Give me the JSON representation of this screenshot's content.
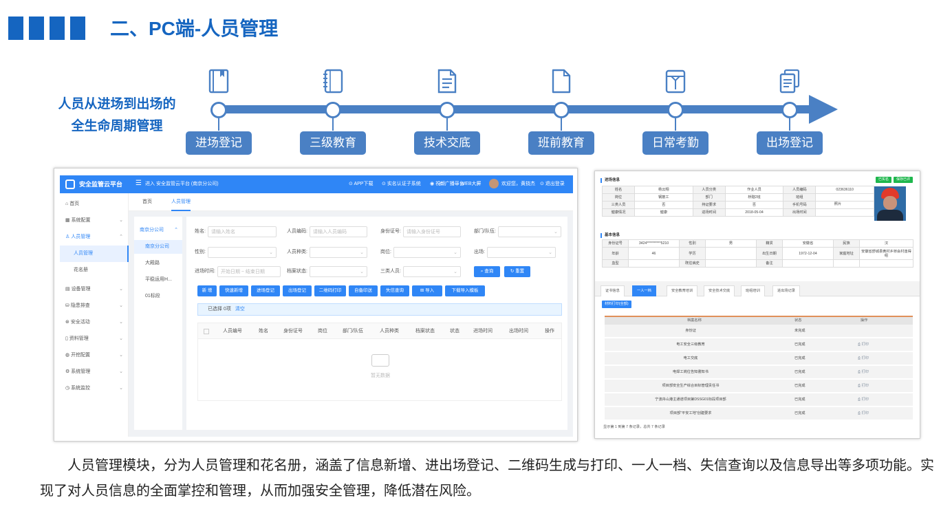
{
  "header": {
    "title": "二、PC端-人员管理"
  },
  "lifecycle": {
    "caption_line1": "人员从进场到出场的",
    "caption_line2": "全生命周期管理",
    "stages": [
      {
        "label": "进场登记",
        "icon": "book-icon"
      },
      {
        "label": "三级教育",
        "icon": "notebook-icon"
      },
      {
        "label": "技术交底",
        "icon": "document-icon"
      },
      {
        "label": "班前教育",
        "icon": "file-icon"
      },
      {
        "label": "日常考勤",
        "icon": "clipboard-icon"
      },
      {
        "label": "出场登记",
        "icon": "copy-icon"
      }
    ],
    "accent_color": "#4a80c4"
  },
  "shot1": {
    "brand": "安全监管云平台",
    "company": "进入 安全监管云平台 (南京分公司)",
    "nav": [
      "APP下载",
      "实名认证子系统",
      "視频",
      "WEB大屏",
      "广播平台",
      "欢迎您，黄挠杰",
      "退出登录"
    ],
    "sidebar": [
      "首页",
      "系统配置",
      "人员管理",
      "人员管理",
      "花名册",
      "设备管理",
      "隐患排查",
      "安全活动",
      "资料管理",
      "开挖配置",
      "系统管理",
      "系统监控"
    ],
    "tabs": [
      "首页",
      "人员管理"
    ],
    "tree": [
      "南京分公司",
      "南京分公司",
      "大殿路",
      "平稳运用H...",
      "01标段"
    ],
    "form": {
      "name_label": "姓名:",
      "name_ph": "请输入姓名",
      "code_label": "人员编码:",
      "code_ph": "请输入人员编码",
      "id_label": "身份证号:",
      "id_ph": "请输入身份证号",
      "team_label": "部门/队伍:",
      "gender_label": "性别:",
      "type_label": "人员种类:",
      "post_label": "岗位:",
      "exit_label": "出场:",
      "time_label": "进场时间:",
      "time_ph": "开始日期 ~ 结束日期",
      "archive_label": "档案状态:",
      "three_label": "三类人员:",
      "search_btn": "查询",
      "reset_btn": "重置"
    },
    "actions": [
      "新 增",
      "快速新增",
      "进场登记",
      "出场登记",
      "二维码打印",
      "自备印送",
      "失信查询",
      "导入",
      "下载导入模板"
    ],
    "selected_text": "已选择 0项",
    "clear_text": "清空",
    "columns": [
      "人员编号",
      "姓名",
      "身份证号",
      "岗位",
      "部门/队伍",
      "人员种类",
      "档案状态",
      "状态",
      "进场时间",
      "出场时间",
      "操作"
    ],
    "empty_text": "暂无数据"
  },
  "shot2": {
    "sec_entry": "进场信息",
    "badges": [
      "已实名",
      "保存已评"
    ],
    "entry_rows": [
      [
        "姓名",
        "杨云翔",
        "人员分类",
        "作业人员",
        "人员编码",
        "023636110"
      ],
      [
        "岗位",
        "钢筋工",
        "部门",
        "桥隧2班",
        "班组",
        ""
      ],
      [
        "三类人员",
        "否",
        "持证要求",
        "否",
        "手机号码",
        ""
      ],
      [
        "健康情况",
        "健康",
        "进场时间",
        "2018-05-04",
        "出场时间",
        ""
      ]
    ],
    "photo_label": "照片",
    "sec_basic": "基本信息",
    "basic_rows": [
      [
        "身份证号",
        "3424**********5210",
        "性别",
        "男",
        "籍贯",
        "安徽省",
        "民族",
        "汉"
      ],
      [
        "年龄",
        "46",
        "学历",
        "",
        "出生日期",
        "1972-12-04",
        "家庭地址",
        "安徽省舒城县黄村乡桥会村逢得组"
      ],
      [
        "血型",
        "",
        "既往病史",
        "",
        "备注",
        "",
        "",
        ""
      ]
    ],
    "tabs": [
      "证书信息",
      "一人一档",
      "安全教育培训",
      "安全技术交底",
      "班组培训",
      "进出场记录"
    ],
    "print_btn": "材料打印(全部)",
    "doc_headers": [
      "档案名称",
      "状态",
      "操作"
    ],
    "docs": [
      {
        "name": "身份证",
        "status": "未完成",
        "action": ""
      },
      {
        "name": "电工安全三级教育",
        "status": "已完成",
        "action": "打印"
      },
      {
        "name": "电工交底",
        "status": "已完成",
        "action": "打印"
      },
      {
        "name": "电焊工岗位告知書知书",
        "status": "已完成",
        "action": "打印"
      },
      {
        "name": "项目部安全生产综合目标管理责任书",
        "status": "已完成",
        "action": "打印"
      },
      {
        "name": "宁波舟山港主通道项目第DSSG01标段项目部",
        "status": "已完成",
        "action": "打印"
      },
      {
        "name": "项目部\"平安工地\"创建要求",
        "status": "已完成",
        "action": "打印"
      }
    ],
    "footer": "显示第 1 到第 7 条记录，总共 7 条记录"
  },
  "description": "人员管理模块，分为人员管理和花名册，涵盖了信息新增、进出场登记、二维码生成与打印、一人一档、失信查询以及信息导出等多项功能。实现了对人员信息的全面掌控和管理，从而加强安全管理，降低潜在风险。"
}
